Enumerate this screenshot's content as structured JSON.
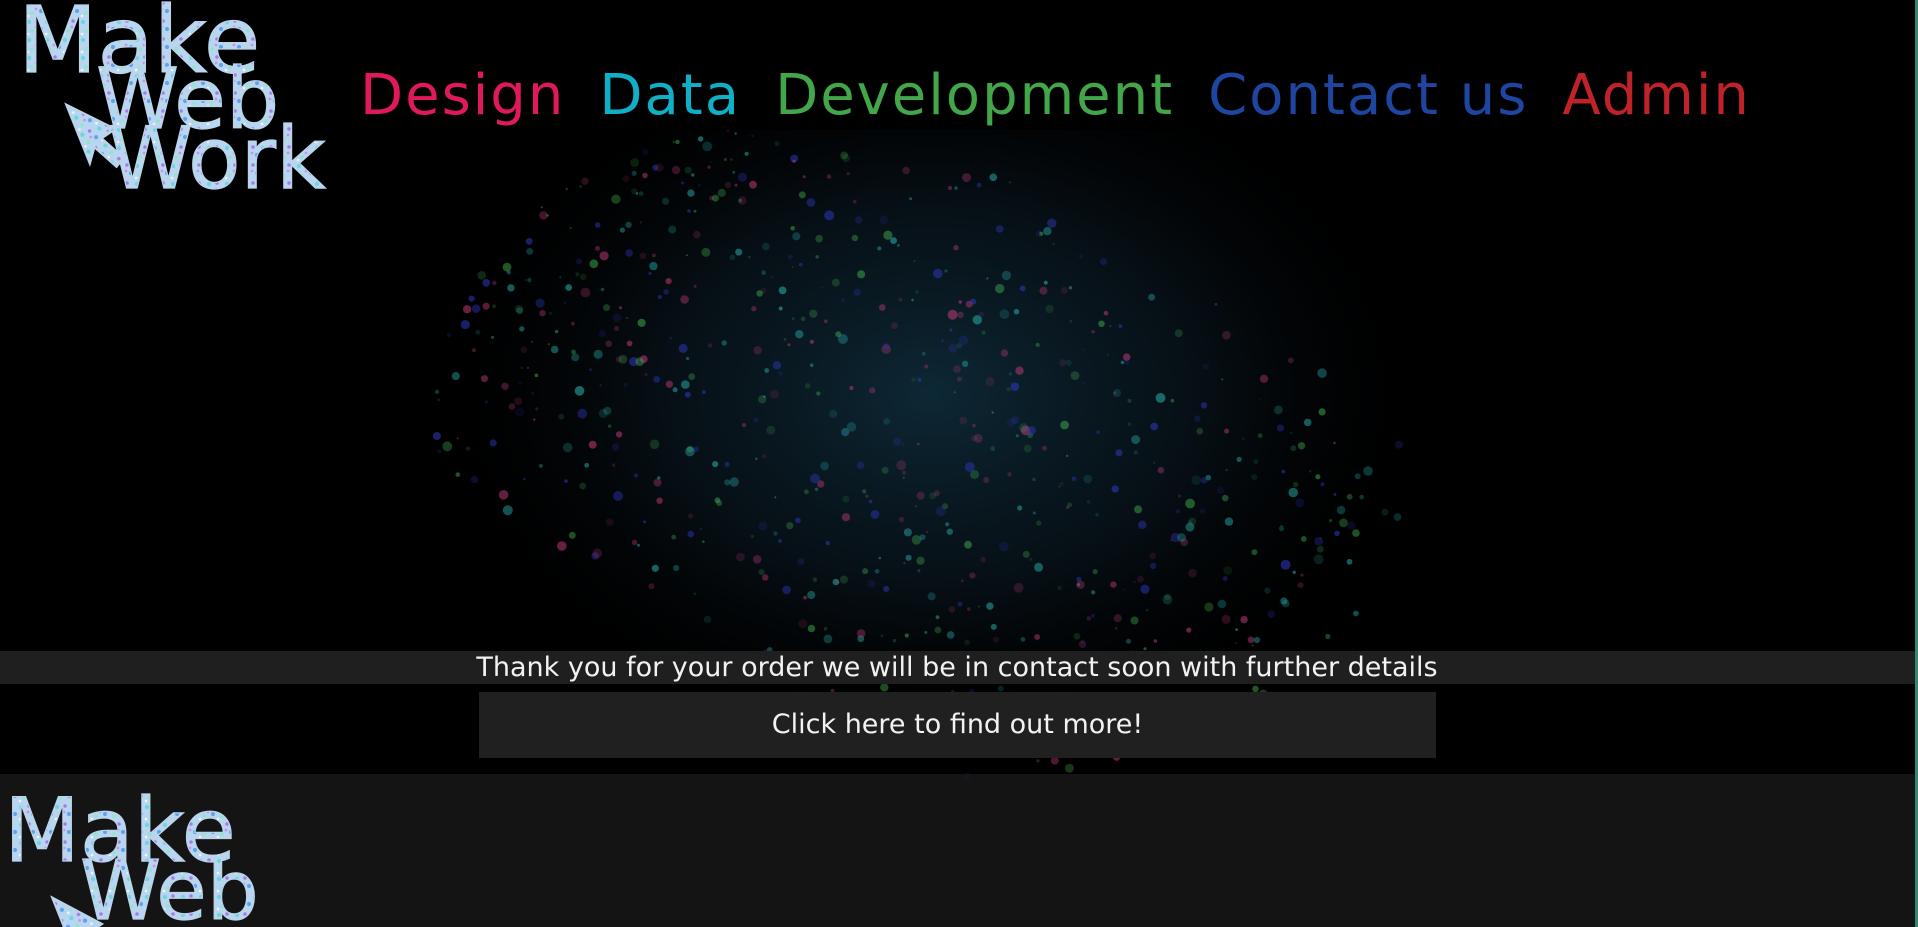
{
  "logo": {
    "name": "logo",
    "words": [
      "Make",
      "Web",
      "Work"
    ]
  },
  "nav": {
    "items": [
      {
        "label": "Design",
        "color": "#e0195c"
      },
      {
        "label": "Data",
        "color": "#0fb0c6"
      },
      {
        "label": "Development",
        "color": "#43a74a"
      },
      {
        "label": "Contact us",
        "color": "#1e45a0"
      },
      {
        "label": "Admin",
        "color": "#c0222a"
      }
    ]
  },
  "banner": {
    "message": "Thank you for your order we will be in contact soon with further details"
  },
  "cta": {
    "label": "Click here to find out more!"
  },
  "footer": {
    "logo_words": [
      "Make",
      "Web"
    ]
  },
  "colors": {
    "background": "#000000",
    "banner_bg": "#1f1f1f",
    "button_bg": "#202020",
    "footer_bg": "#161616",
    "text": "#f2f2f2",
    "accent_edge": "#2e8b6f"
  }
}
